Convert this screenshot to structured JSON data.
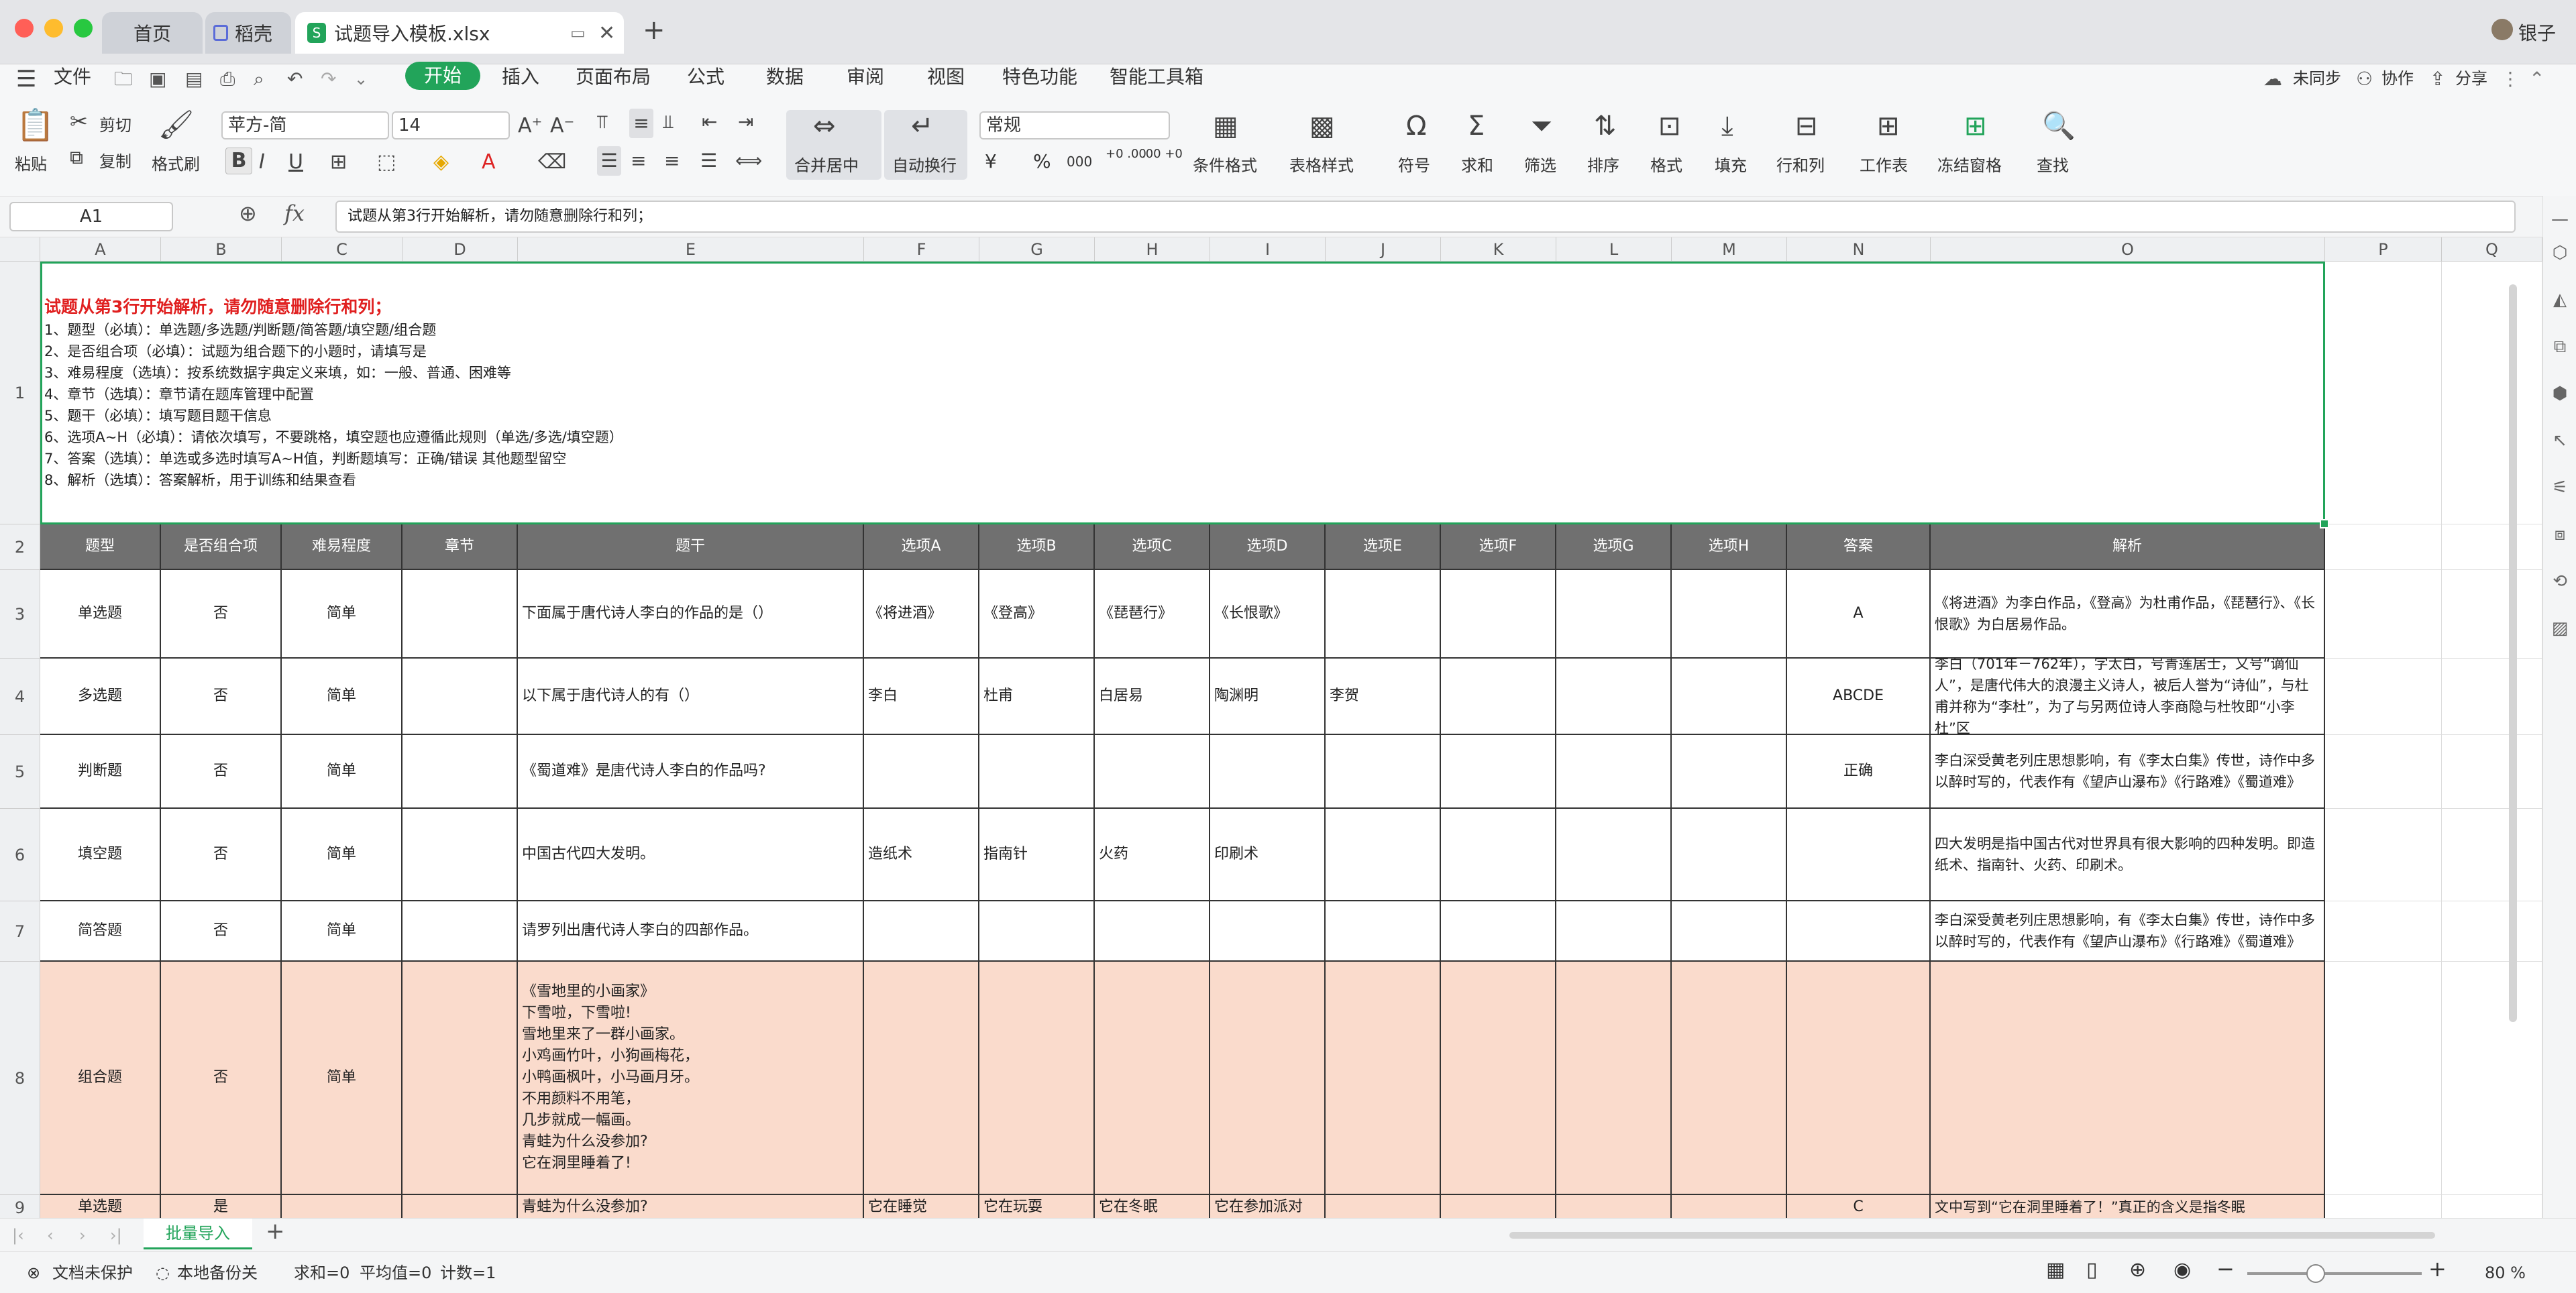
{
  "window": {
    "tabs": [
      {
        "label": "首页"
      },
      {
        "label": "稻壳"
      },
      {
        "label": "试题导入模板.xlsx"
      }
    ],
    "user": "银子",
    "new_tab": "+"
  },
  "menu": {
    "file": "文件",
    "items": [
      "开始",
      "插入",
      "页面布局",
      "公式",
      "数据",
      "审阅",
      "视图",
      "特色功能",
      "智能工具箱"
    ],
    "right": [
      "未同步",
      "协作",
      "分享"
    ]
  },
  "toolbar": {
    "paste": "粘贴",
    "cut": "剪切",
    "copy": "复制",
    "format_painter": "格式刷",
    "font_name": "苹方-简",
    "font_size": "14",
    "merge": "合并居中",
    "wrap": "自动换行",
    "number_format": "常规",
    "cond_format": "条件格式",
    "table_style": "表格样式",
    "symbol": "符号",
    "sum": "求和",
    "filter": "筛选",
    "sort": "排序",
    "format": "格式",
    "fill": "填充",
    "rowcol": "行和列",
    "worksheet": "工作表",
    "freeze": "冻结窗格",
    "find": "查找",
    "currency": "¥",
    "percent": "%",
    "thousands": "000",
    "inc_decimal": "+0 .00",
    "dec_decimal": ".00 +0"
  },
  "formula_bar": {
    "name_box": "A1",
    "fx": "fx",
    "content": "试题从第3行开始解析，请勿随意删除行和列；"
  },
  "columns": [
    "A",
    "B",
    "C",
    "D",
    "E",
    "F",
    "G",
    "H",
    "I",
    "J",
    "K",
    "L",
    "M",
    "N",
    "O",
    "P",
    "Q"
  ],
  "rows": [
    "1",
    "2",
    "3",
    "4",
    "5",
    "6",
    "7",
    "8",
    "9"
  ],
  "row1": {
    "title": "试题从第3行开始解析，请勿随意删除行和列；",
    "lines": [
      "1、题型（必填）：单选题/多选题/判断题/简答题/填空题/组合题",
      "2、是否组合项（必填）：试题为组合题下的小题时，请填写是",
      "3、难易程度（选填）：按系统数据字典定义来填，如：一般、普通、困难等",
      "4、章节（选填）：章节请在题库管理中配置",
      "5、题干（必填）：填写题目题干信息",
      "6、选项A~H（必填）：请依次填写，不要跳格，填空题也应遵循此规则（单选/多选/填空题）",
      "7、答案（选填）：单选或多选时填写A~H值，判断题填写：正确/错误 其他题型留空",
      "8、解析（选填）：答案解析，用于训练和结果查看"
    ]
  },
  "headers": [
    "题型",
    "是否组合项",
    "难易程度",
    "章节",
    "题干",
    "选项A",
    "选项B",
    "选项C",
    "选项D",
    "选项E",
    "选项F",
    "选项G",
    "选项H",
    "答案",
    "解析"
  ],
  "data_rows": [
    [
      "单选题",
      "否",
      "简单",
      "",
      "下面属于唐代诗人李白的作品的是（）",
      "《将进酒》",
      "《登高》",
      "《琵琶行》",
      "《长恨歌》",
      "",
      "",
      "",
      "",
      "A",
      "《将进酒》为李白作品，《登高》为杜甫作品，《琵琶行》、《长恨歌》为白居易作品。"
    ],
    [
      "多选题",
      "否",
      "简单",
      "",
      "以下属于唐代诗人的有（）",
      "李白",
      "杜甫",
      "白居易",
      "陶渊明",
      "李贺",
      "",
      "",
      "",
      "ABCDE",
      "李白（701年－762年），字太白，号青莲居士，又号“谪仙人”，是唐代伟大的浪漫主义诗人，被后人誉为“诗仙”，与杜甫并称为“李杜”，为了与另两位诗人李商隐与杜牧即“小李杜”区"
    ],
    [
      "判断题",
      "否",
      "简单",
      "",
      "《蜀道难》是唐代诗人李白的作品吗?",
      "",
      "",
      "",
      "",
      "",
      "",
      "",
      "",
      "正确",
      "李白深受黄老列庄思想影响，有《李太白集》传世，诗作中多以醉时写的，代表作有《望庐山瀑布》《行路难》《蜀道难》"
    ],
    [
      "填空题",
      "否",
      "简单",
      "",
      "中国古代四大发明。",
      "造纸术",
      "指南针",
      "火药",
      "印刷术",
      "",
      "",
      "",
      "",
      "",
      "四大发明是指中国古代对世界具有很大影响的四种发明。即造纸术、指南针、火药、印刷术。"
    ],
    [
      "简答题",
      "否",
      "简单",
      "",
      "请罗列出唐代诗人李白的四部作品。",
      "",
      "",
      "",
      "",
      "",
      "",
      "",
      "",
      "",
      "李白深受黄老列庄思想影响，有《李太白集》传世，诗作中多以醉时写的，代表作有《望庐山瀑布》《行路难》《蜀道难》"
    ],
    [
      "组合题",
      "否",
      "简单",
      "",
      "《雪地里的小画家》\n下雪啦，下雪啦!\n雪地里来了一群小画家。\n小鸡画竹叶，小狗画梅花，\n小鸭画枫叶，小马画月牙。\n不用颜料不用笔，\n几步就成一幅画。\n青蛙为什么没参加?\n它在洞里睡着了!",
      "",
      "",
      "",
      "",
      "",
      "",
      "",
      "",
      "",
      ""
    ],
    [
      "单选题",
      "是",
      "",
      "",
      "青蛙为什么没参加?",
      "它在睡觉",
      "它在玩耍",
      "它在冬眠",
      "它在参加派对",
      "",
      "",
      "",
      "",
      "C",
      "文中写到“它在洞里睡着了！”真正的含义是指冬眠"
    ]
  ],
  "sheet": {
    "name": "批量导入",
    "add": "+"
  },
  "status": {
    "protect": "文档未保护",
    "backup": "本地备份关",
    "sum": "求和=0",
    "avg": "平均值=0",
    "count": "计数=1",
    "zoom": "80 %"
  },
  "colors": {
    "accent": "#22a45a",
    "header_fill": "#707070",
    "peach": "#fadbcc",
    "title_red": "#e02020"
  }
}
